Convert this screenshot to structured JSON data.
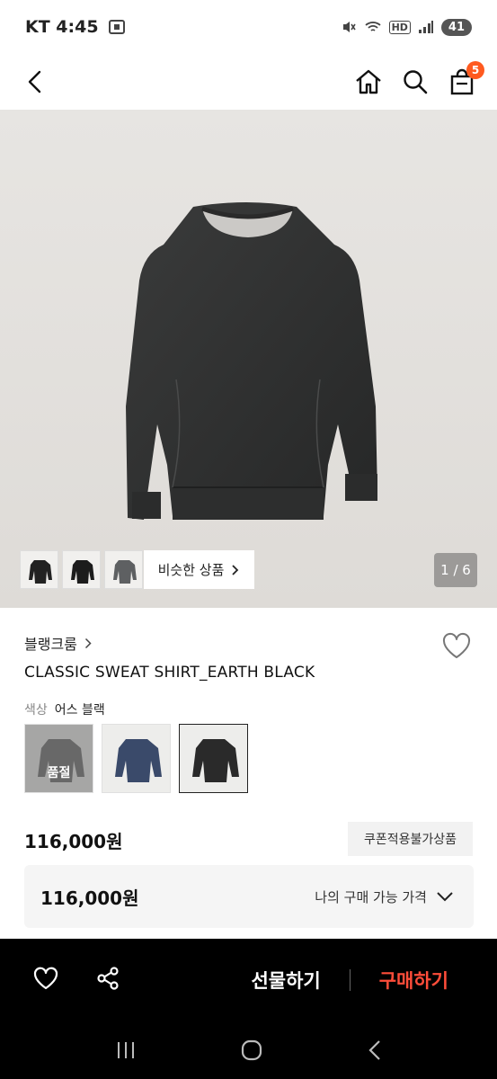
{
  "status_bar": {
    "carrier_time": "KT 4:45",
    "signal_label": "HD",
    "battery": "41"
  },
  "header": {
    "back_icon": "back-chevron-icon",
    "home_icon": "home-icon",
    "search_icon": "search-icon",
    "cart_icon": "shopping-bag-icon",
    "cart_count": "5"
  },
  "gallery": {
    "similar_label": "비슷한 상품",
    "page_indicator": "1 / 6",
    "image_bg": "#e5e3e0"
  },
  "product": {
    "brand": "블랭크룸",
    "name": "CLASSIC SWEAT SHIRT_EARTH BLACK",
    "color_label": "색상",
    "color_value": "어스 블랙",
    "swatches": [
      {
        "color": "#7c7c7c",
        "soldout_label": "품절"
      },
      {
        "color": "#3a4a6a"
      },
      {
        "color": "#2a2a2a"
      }
    ],
    "price": "116,000원",
    "coupon_tag": "쿠폰적용불가상품",
    "my_price": "116,000원",
    "my_price_label": "나의 구매 가능 가격"
  },
  "action_bar": {
    "gift_label": "선물하기",
    "buy_label": "구매하기",
    "buy_color": "#ff4d3a"
  }
}
